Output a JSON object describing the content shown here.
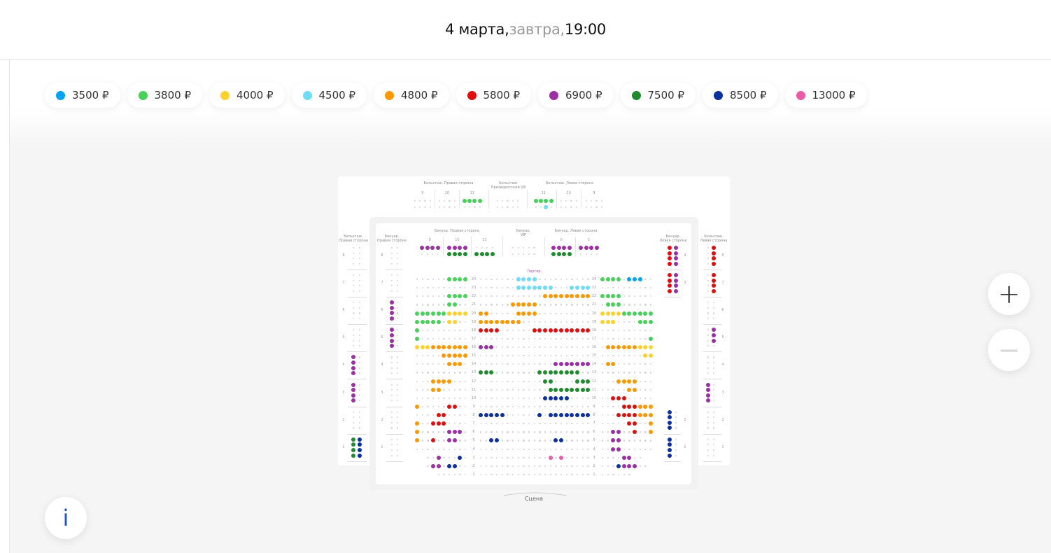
{
  "header": {
    "date": "4 марта,",
    "relative": " завтра,",
    "time": " 19:00"
  },
  "prices": [
    {
      "label": "3500 ₽",
      "code": "a",
      "color": "#00a3f2"
    },
    {
      "label": "3800 ₽",
      "code": "b",
      "color": "#47d05a"
    },
    {
      "label": "4000 ₽",
      "code": "c",
      "color": "#ffd12e"
    },
    {
      "label": "4500 ₽",
      "code": "d",
      "color": "#6fdcf5"
    },
    {
      "label": "4800 ₽",
      "code": "e",
      "color": "#ff9800"
    },
    {
      "label": "5800 ₽",
      "code": "f",
      "color": "#e00d0d"
    },
    {
      "label": "6900 ₽",
      "code": "g",
      "color": "#9b2fa3"
    },
    {
      "label": "7500 ₽",
      "code": "h",
      "color": "#1f8a2e"
    },
    {
      "label": "8500 ₽",
      "code": "i",
      "color": "#0a2f9e"
    },
    {
      "label": "13000 ₽",
      "code": "j",
      "color": "#ec5ba8"
    }
  ],
  "unavailable_color": "#d4d4d4",
  "balcony_top": {
    "title_right": "Бельэтаж. Правая сторона",
    "title_vip_1": "Бельэтаж.",
    "title_vip_2": "Президентский VIP",
    "title_left": "Бельэтаж. Левая сторона",
    "sections": [
      {
        "label": "9",
        "rows": [
          "....",
          "...."
        ]
      },
      {
        "label": "10",
        "rows": [
          "....",
          "...."
        ]
      },
      {
        "label": "11",
        "rows": [
          "bbbb",
          "...."
        ]
      },
      {
        "label": "",
        "rows": [
          ".....",
          "....."
        ]
      },
      {
        "label": "11",
        "rows": [
          "bbbb",
          "..d."
        ]
      },
      {
        "label": "10",
        "rows": [
          "....",
          "...."
        ]
      },
      {
        "label": "9",
        "rows": [
          "....",
          "...."
        ]
      }
    ]
  },
  "benoir_top": {
    "title_right": "Бенуар. Правая сторона",
    "title_vip_1": "Бенуар.",
    "title_vip_2": "VIP",
    "title_left": "Бенуар. Левая сторона",
    "sections": [
      {
        "label": "9",
        "rows": [
          "gggg",
          "...."
        ]
      },
      {
        "label": "10",
        "rows": [
          "gggg",
          "hhhh"
        ]
      },
      {
        "label": "11",
        "rows": [
          "....",
          "hhhh"
        ]
      },
      {
        "label": "",
        "rows": [
          ".....",
          "....."
        ]
      },
      {
        "label": "6",
        "rows": [
          "gggg",
          "hhhh"
        ]
      },
      {
        "label": "5",
        "rows": [
          "gggg",
          "...."
        ]
      }
    ]
  },
  "side": {
    "balcony_right": {
      "title_1": "Бельэтаж.",
      "title_2": "Правая сторона",
      "boxes": [
        {
          "label": "8",
          "seats": [
            "..",
            "..",
            "..",
            ".."
          ]
        },
        {
          "label": "7",
          "seats": [
            "..",
            "..",
            "..",
            ".."
          ]
        },
        {
          "label": "6",
          "seats": [
            "..",
            "..",
            "..",
            ".."
          ]
        },
        {
          "label": "5",
          "seats": [
            "..",
            "..",
            "..",
            ".."
          ]
        },
        {
          "label": "4",
          "seats": [
            "g.",
            "g.",
            "g.",
            "g."
          ]
        },
        {
          "label": "3",
          "seats": [
            "g.",
            "g.",
            "g.",
            "g."
          ]
        },
        {
          "label": "2",
          "seats": [
            "..",
            "..",
            "..",
            ".."
          ]
        },
        {
          "label": "1",
          "seats": [
            "hi",
            "hi",
            "hi",
            "hi"
          ]
        }
      ]
    },
    "benoir_right": {
      "title_1": "Бенуар.",
      "title_2": "Правая сторона",
      "boxes": [
        {
          "label": "8",
          "seats": [
            "..",
            "..",
            "..",
            ".."
          ]
        },
        {
          "label": "7",
          "seats": [
            "..",
            "..",
            "..",
            ".."
          ]
        },
        {
          "label": "6",
          "seats": [
            "g.",
            "g.",
            "g.",
            "g."
          ]
        },
        {
          "label": "5",
          "seats": [
            "g.",
            "g.",
            "g.",
            "g."
          ]
        },
        {
          "label": "4",
          "seats": [
            "..",
            "..",
            "..",
            ".."
          ]
        },
        {
          "label": "3",
          "seats": [
            "..",
            "..",
            "..",
            ".."
          ]
        },
        {
          "label": "2",
          "seats": [
            "..",
            "..",
            "..",
            ".."
          ]
        },
        {
          "label": "1",
          "seats": [
            "..",
            "..",
            "..",
            ".."
          ]
        }
      ]
    },
    "benoir_left": {
      "title_1": "Бенуар.",
      "title_2": "Левая сторона",
      "boxes": [
        {
          "label": "4",
          "seats": [
            "fg",
            "fg",
            "fg",
            "fg"
          ]
        },
        {
          "label": "3",
          "seats": [
            "fg",
            "fg",
            "fg",
            "fg"
          ]
        },
        null,
        null,
        null,
        null,
        {
          "label": "2",
          "seats": [
            "i.",
            "i.",
            "i.",
            "i."
          ]
        },
        {
          "label": "1",
          "seats": [
            "i.",
            "i.",
            "i.",
            "i."
          ]
        }
      ]
    },
    "balcony_left": {
      "title_1": "Бельэтаж.",
      "title_2": "Левая сторона",
      "boxes": [
        {
          "label": "8",
          "seats": [
            ".f",
            ".f",
            ".f",
            ".f"
          ]
        },
        {
          "label": "7",
          "seats": [
            ".f",
            ".f",
            ".f",
            ".f"
          ]
        },
        {
          "label": "6",
          "seats": [
            "..",
            "..",
            "..",
            ".."
          ]
        },
        {
          "label": "5",
          "seats": [
            ".g",
            ".g",
            ".g",
            ".."
          ]
        },
        {
          "label": "4",
          "seats": [
            "..",
            "..",
            "..",
            ".."
          ]
        },
        {
          "label": "3",
          "seats": [
            "g.",
            "g.",
            "g.",
            "g."
          ]
        },
        {
          "label": "2",
          "seats": [
            "..",
            "..",
            "..",
            ".."
          ]
        },
        {
          "label": "1",
          "seats": [
            "..",
            "..",
            "..",
            ".."
          ]
        }
      ]
    }
  },
  "parterre": {
    "title": "Партер",
    "rows": [
      {
        "row": "24",
        "left": "......bbbb",
        "center": ".......dddd..........",
        "right": "bbbb.aaa.."
      },
      {
        "row": "23",
        "left": "..........",
        "center": ".......ddddddd...dddd",
        "right": ".........."
      },
      {
        "row": "22",
        "left": "......bbbb",
        "center": "............eeeeeeeee",
        "right": "bbbb......"
      },
      {
        "row": "21",
        "left": "......bb..",
        "center": "......eeeee..........",
        "right": ".bbb......"
      },
      {
        "row": "20",
        "left": "bbbbbbcccc",
        "center": "ee.....eeee..........",
        "right": "ccccbbbbbb"
      },
      {
        "row": "19",
        "left": "bbbbb.cc..",
        "center": "eeeeeeee.............",
        "right": "ccc....bbb"
      },
      {
        "row": "18",
        "left": "b.........",
        "center": "ffff......fffffffffff",
        "right": ".........."
      },
      {
        "row": "17",
        "left": "b.........",
        "center": ".....................",
        "right": ".........b"
      },
      {
        "row": "16",
        "left": "ccceeeeeee",
        "center": "ggg..................",
        "right": ".eeeeeeccc"
      },
      {
        "row": "15",
        "left": ".....eeeee",
        "center": ".....................",
        "right": "........cc"
      },
      {
        "row": "14",
        "left": "......eee.",
        "center": "..............ggggggg",
        "right": ".ee......."
      },
      {
        "row": "13",
        "left": "..........",
        "center": "hhh........hhhhhhhh..",
        "right": ".........."
      },
      {
        "row": "12",
        "left": "...eeee...",
        "center": "............hh....hhh",
        "right": "...eeee..."
      },
      {
        "row": "11",
        "left": "...ee.....",
        "center": ".............hhhhhhhh",
        "right": ".....ee..."
      },
      {
        "row": "10",
        "left": "..........",
        "center": "............iiiii....",
        "right": "..fff....."
      },
      {
        "row": "9",
        "left": "e.....ff..",
        "center": ".....................",
        "right": "....fffeee"
      },
      {
        "row": "8",
        "left": "....ff....",
        "center": "iiiii......i.iiiiiiii",
        "right": "...ffffeee"
      },
      {
        "row": "7",
        "left": "e..fff....",
        "center": ".....................",
        "right": ".....ff..e"
      },
      {
        "row": "6",
        "left": "e.....ggg.",
        "center": ".....................",
        "right": "..gg..f..e"
      },
      {
        "row": "5",
        "left": "e..f..gg..",
        "center": "..ii..........ii.....",
        "right": "..gg......"
      },
      {
        "row": "4",
        "left": "..........",
        "center": ".....................",
        "right": "..gg......"
      },
      {
        "row": "3",
        "left": "  ..g...i.",
        "center": ".............j.j.....",
        "right": "....gg..  "
      },
      {
        "row": "2",
        "left": "  .gg.ii..",
        "center": ".....................",
        "right": "...iggg.. "
      },
      {
        "row": "1",
        "left": "    ......",
        "center": ".....................",
        "right": "......    "
      }
    ]
  },
  "stage": "Сцена",
  "controls": {
    "zoom_in": "+",
    "zoom_out": "−",
    "info": "i"
  }
}
